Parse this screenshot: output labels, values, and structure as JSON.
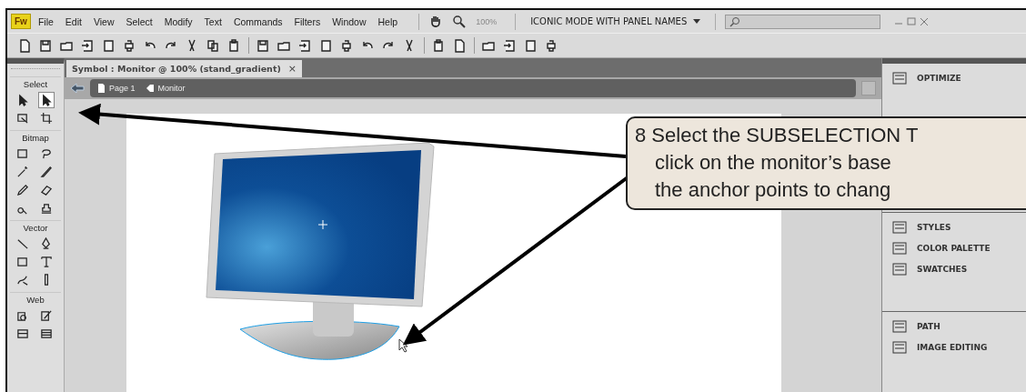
{
  "app": {
    "logo": "Fw",
    "menus": [
      "File",
      "Edit",
      "View",
      "Select",
      "Modify",
      "Text",
      "Commands",
      "Filters",
      "Window",
      "Help"
    ],
    "zoom": "100%",
    "workspace": "ICONIC MODE WITH PANEL NAMES"
  },
  "document_tab": {
    "title": "Symbol : Monitor @ 100% (stand_gradient)",
    "close": "×"
  },
  "breadcrumb": [
    "Page 1",
    "Monitor"
  ],
  "tool_groups": [
    {
      "label": "Select",
      "tools": [
        {
          "selected": false
        },
        {
          "selected": true
        },
        {
          "selected": false
        },
        {
          "selected": false
        }
      ]
    },
    {
      "label": "Bitmap",
      "tools": [
        {
          "selected": false
        },
        {
          "selected": false
        },
        {
          "selected": false
        },
        {
          "selected": false
        },
        {
          "selected": false
        },
        {
          "selected": false
        },
        {
          "selected": false
        },
        {
          "selected": false
        }
      ]
    },
    {
      "label": "Vector",
      "tools": [
        {
          "selected": false
        },
        {
          "selected": false
        },
        {
          "selected": false
        },
        {
          "selected": false
        },
        {
          "selected": false
        },
        {
          "selected": false
        }
      ]
    },
    {
      "label": "Web",
      "tools": [
        {
          "selected": false
        },
        {
          "selected": false
        },
        {
          "selected": false
        },
        {
          "selected": false
        }
      ]
    }
  ],
  "panel_groups": [
    {
      "items": [
        {
          "label": "OPTIMIZE"
        }
      ]
    },
    {
      "items": [
        {
          "label": "STYLES"
        },
        {
          "label": "COLOR PALETTE"
        },
        {
          "label": "SWATCHES"
        }
      ]
    },
    {
      "items": [
        {
          "label": "PATH"
        },
        {
          "label": "IMAGE EDITING"
        }
      ]
    }
  ],
  "callout": {
    "lines": [
      "8  Select the SUBSELECTION T",
      "click on the monitor’s base",
      "the anchor points to chang"
    ]
  }
}
